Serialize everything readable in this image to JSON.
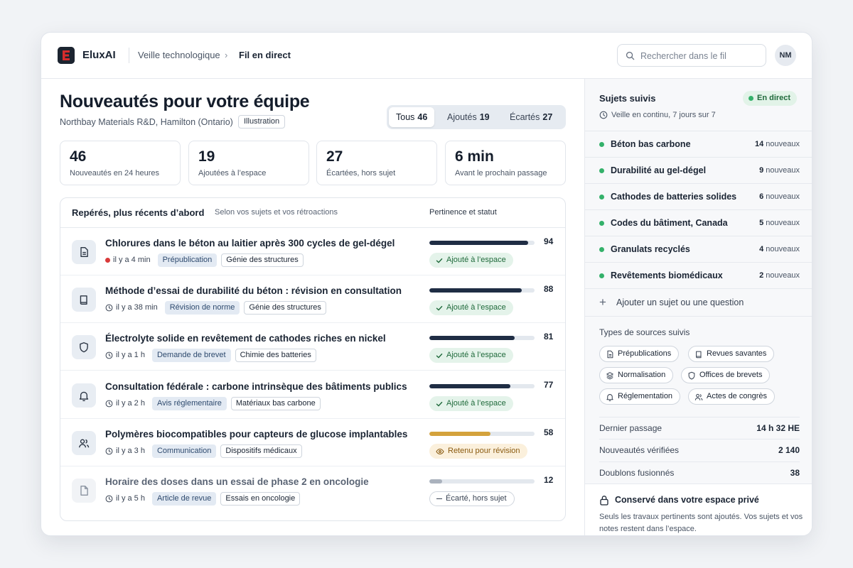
{
  "header": {
    "brand": "EluxAI",
    "breadcrumb_parent": "Veille technologique",
    "breadcrumb_current": "Fil en direct",
    "search_placeholder": "Rechercher dans le fil",
    "avatar_initials": "NM",
    "logo_color": "#d62c2c"
  },
  "main": {
    "title": "Nouveautés pour votre équipe",
    "org": "Northbay Materials R&D, Hamilton (Ontario)",
    "badge": "Illustration",
    "filters": [
      {
        "label": "Tous",
        "count": "46"
      },
      {
        "label": "Ajoutés",
        "count": "19"
      },
      {
        "label": "Écartés",
        "count": "27"
      }
    ],
    "stats": [
      {
        "value": "46",
        "label": "Nouveautés en 24 heures"
      },
      {
        "value": "19",
        "label": "Ajoutées à l’espace"
      },
      {
        "value": "27",
        "label": "Écartées, hors sujet"
      },
      {
        "value": "6 min",
        "label": "Avant le prochain passage"
      }
    ],
    "feed": {
      "title": "Repérés, plus récents d’abord",
      "subtitle": "Selon vos sujets et vos rétroactions",
      "column_right": "Pertinence et statut",
      "items": [
        {
          "title": "Chlorures dans le béton au laitier après 300 cycles de gel-dégel",
          "time": "il y a 4 min",
          "type": "Prépublication",
          "domain": "Génie des structures",
          "score": 94,
          "status": "Ajouté à l’espace",
          "icon": "document-icon"
        },
        {
          "title": "Méthode d’essai de durabilité du béton : révision en consultation",
          "time": "il y a 38 min",
          "type": "Révision de norme",
          "domain": "Génie des structures",
          "score": 88,
          "status": "Ajouté à l’espace",
          "icon": "book-icon"
        },
        {
          "title": "Électrolyte solide en revêtement de cathodes riches en nickel",
          "time": "il y a 1 h",
          "type": "Demande de brevet",
          "domain": "Chimie des batteries",
          "score": 81,
          "status": "Ajouté à l’espace",
          "icon": "shield-icon"
        },
        {
          "title": "Consultation fédérale : carbone intrinsèque des bâtiments publics",
          "time": "il y a 2 h",
          "type": "Avis réglementaire",
          "domain": "Matériaux bas carbone",
          "score": 77,
          "status": "Ajouté à l’espace",
          "icon": "bell-icon"
        },
        {
          "title": "Polymères biocompatibles pour capteurs de glucose implantables",
          "time": "il y a 3 h",
          "type": "Communication",
          "domain": "Dispositifs médicaux",
          "score": 58,
          "status": "Retenu pour révision",
          "icon": "users-icon"
        },
        {
          "title": "Horaire des doses dans un essai de phase 2 en oncologie",
          "time": "il y a 5 h",
          "type": "Article de revue",
          "domain": "Essais en oncologie",
          "score": 12,
          "status": "Écarté, hors sujet",
          "icon": "file-icon"
        }
      ]
    }
  },
  "sidebar": {
    "title": "Sujets suivis",
    "live_label": "En direct",
    "subtitle": "Veille en continu, 7 jours sur 7",
    "new_suffix": "nouveaux",
    "topics": [
      {
        "name": "Béton bas carbone",
        "count": "14"
      },
      {
        "name": "Durabilité au gel-dégel",
        "count": "9"
      },
      {
        "name": "Cathodes de batteries solides",
        "count": "6"
      },
      {
        "name": "Codes du bâtiment, Canada",
        "count": "5"
      },
      {
        "name": "Granulats recyclés",
        "count": "4"
      },
      {
        "name": "Revêtements biomédicaux",
        "count": "2"
      }
    ],
    "add_topic": "Ajouter un sujet ou une question",
    "sources_title": "Types de sources suivis",
    "sources": [
      {
        "label": "Prépublications",
        "icon": "document-icon"
      },
      {
        "label": "Revues savantes",
        "icon": "book-icon"
      },
      {
        "label": "Normalisation",
        "icon": "layers-icon"
      },
      {
        "label": "Offices de brevets",
        "icon": "shield-icon"
      },
      {
        "label": "Réglementation",
        "icon": "bell-icon"
      },
      {
        "label": "Actes de congrès",
        "icon": "users-icon"
      }
    ],
    "metrics": [
      {
        "label": "Dernier passage",
        "value": "14 h 32 HE"
      },
      {
        "label": "Nouveautés vérifiées",
        "value": "2 140"
      },
      {
        "label": "Doublons fusionnés",
        "value": "38"
      }
    ],
    "private_title": "Conservé dans votre espace privé",
    "private_text": "Seuls les travaux pertinents sont ajoutés. Vos sujets et vos notes restent dans l’espace."
  }
}
